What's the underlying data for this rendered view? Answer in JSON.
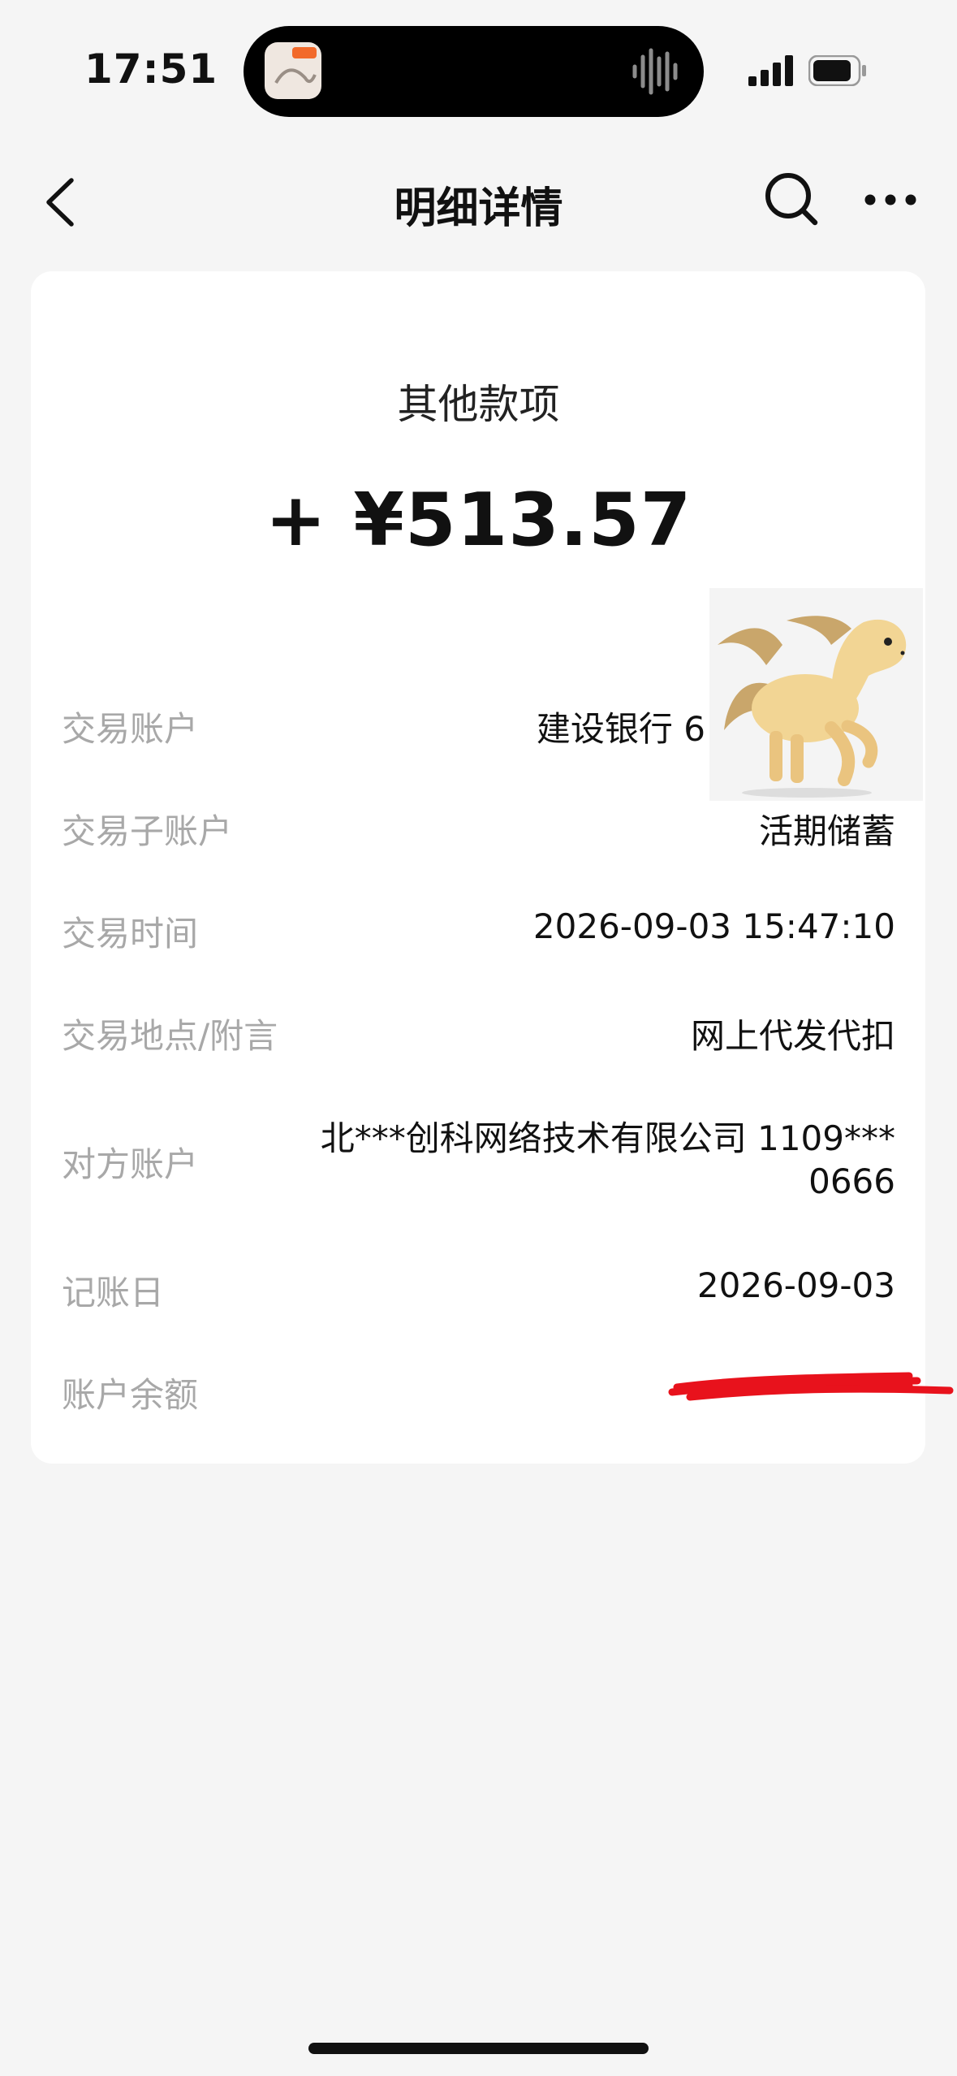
{
  "status_bar": {
    "time": "17:51",
    "signal_icon": "cellular-signal-icon",
    "battery_icon": "battery-icon"
  },
  "nav": {
    "title": "明细详情",
    "back_icon": "chevron-left-icon",
    "search_icon": "search-icon",
    "more_icon": "more-dots-icon"
  },
  "summary": {
    "category": "其他款项",
    "amount": "+ ¥513.57"
  },
  "details": [
    {
      "label": "交易账户",
      "value": "建设银行 6"
    },
    {
      "label": "交易子账户",
      "value": "活期储蓄"
    },
    {
      "label": "交易时间",
      "value": "2026-09-03 15:47:10"
    },
    {
      "label": "交易地点/附言",
      "value": "网上代发代扣"
    },
    {
      "label": "对方账户",
      "value_line1": "北***创科网络技术有限公司 1109***",
      "value_line2": "0666"
    },
    {
      "label": "记账日",
      "value": "2026-09-03"
    },
    {
      "label": "账户余额",
      "value": ""
    }
  ],
  "overlays": {
    "sticker": "horse-sticker-image",
    "redaction": "red-scribble-redaction"
  },
  "colors": {
    "background": "#f5f5f5",
    "card": "#ffffff",
    "label": "#a8a8a8",
    "value": "#111111",
    "redaction": "#e8121c"
  }
}
